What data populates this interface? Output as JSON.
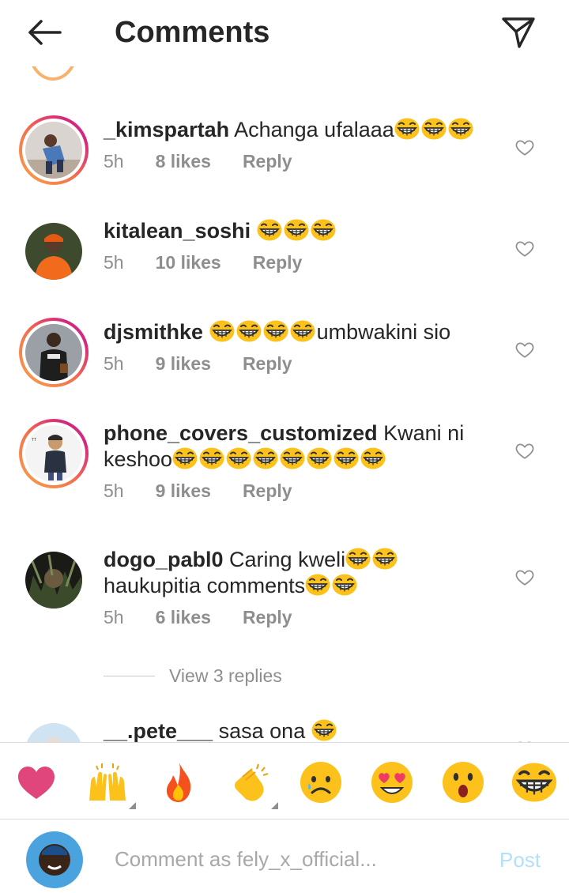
{
  "header": {
    "title": "Comments"
  },
  "comments": [
    {
      "username": "_kimspartah",
      "text": "Achanga ufalaaa",
      "emoji_count": 3,
      "time": "5h",
      "likes": "8 likes",
      "reply": "Reply",
      "has_story_ring": true
    },
    {
      "username": "kitalean_soshi",
      "text": "",
      "emoji_count": 3,
      "time": "5h",
      "likes": "10 likes",
      "reply": "Reply",
      "has_story_ring": false
    },
    {
      "username": "djsmithke",
      "text_after_emoji": "umbwakini sio",
      "emoji_count": 4,
      "time": "5h",
      "likes": "9 likes",
      "reply": "Reply",
      "has_story_ring": true
    },
    {
      "username": "phone_covers_customized",
      "text": "Kwani ni",
      "text_line2": "keshoo",
      "emoji_count": 8,
      "time": "5h",
      "likes": "9 likes",
      "reply": "Reply",
      "has_story_ring": true
    },
    {
      "username": "dogo_pabl0",
      "text": "Caring kweli",
      "text_line2": "haukupitia comments",
      "emoji_count": 2,
      "emoji_count_line2": 2,
      "time": "5h",
      "likes": "6 likes",
      "reply": "Reply",
      "has_story_ring": false,
      "view_replies": "View 3 replies"
    },
    {
      "username": "__.pete___",
      "text": "sasa ona",
      "emoji_count": 1,
      "has_story_ring": false
    }
  ],
  "emoji_bar": [
    {
      "name": "red-heart",
      "has_variants": false
    },
    {
      "name": "raising-hands",
      "has_variants": true
    },
    {
      "name": "fire",
      "has_variants": false
    },
    {
      "name": "clapping-hands",
      "has_variants": true
    },
    {
      "name": "crying-face",
      "has_variants": false
    },
    {
      "name": "heart-eyes",
      "has_variants": false
    },
    {
      "name": "astonished-face",
      "has_variants": false
    },
    {
      "name": "grinning-squinting-face",
      "has_variants": false
    }
  ],
  "composer": {
    "placeholder": "Comment as fely_x_official...",
    "post_label": "Post"
  },
  "colors": {
    "text": "#262626",
    "meta": "#8e8e8e",
    "post_disabled": "#b2dffc",
    "heart": "#e0457b",
    "ring_orange": "#f9a44b",
    "ring_pink": "#d6287b"
  }
}
